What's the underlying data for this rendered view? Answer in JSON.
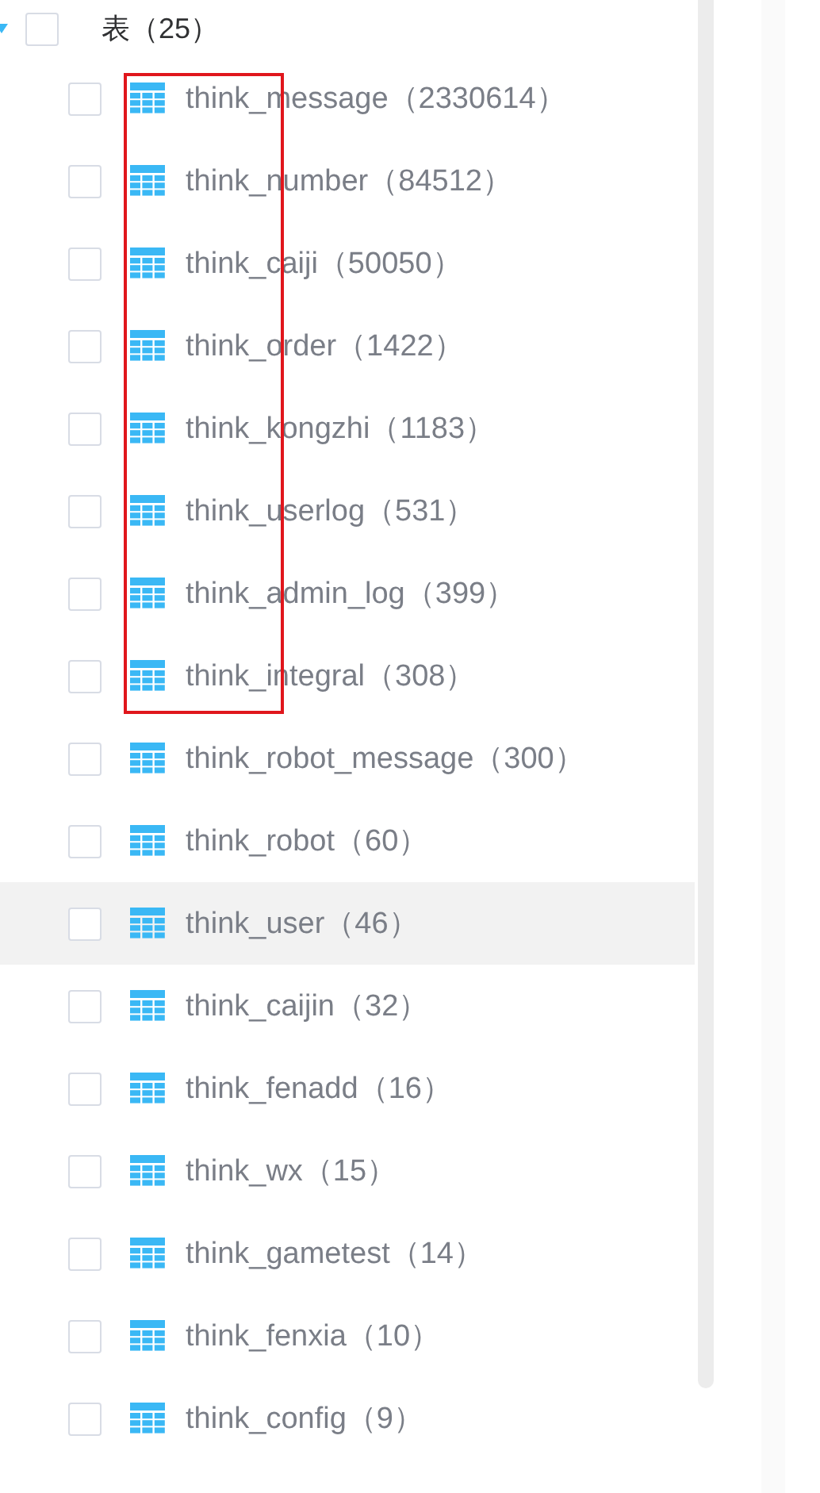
{
  "annotation": {
    "kind": "frame"
  },
  "tree": {
    "label": "表（25）",
    "expanded": true,
    "checked": false,
    "children": [
      {
        "label": "think_message（2330614）",
        "checked": false,
        "hovered": false
      },
      {
        "label": "think_number（84512）",
        "checked": false,
        "hovered": false
      },
      {
        "label": "think_caiji（50050）",
        "checked": false,
        "hovered": false
      },
      {
        "label": "think_order（1422）",
        "checked": false,
        "hovered": false
      },
      {
        "label": "think_kongzhi（1183）",
        "checked": false,
        "hovered": false
      },
      {
        "label": "think_userlog（531）",
        "checked": false,
        "hovered": false
      },
      {
        "label": "think_admin_log（399）",
        "checked": false,
        "hovered": false
      },
      {
        "label": "think_integral（308）",
        "checked": false,
        "hovered": false
      },
      {
        "label": "think_robot_message（300）",
        "checked": false,
        "hovered": false
      },
      {
        "label": "think_robot（60）",
        "checked": false,
        "hovered": false
      },
      {
        "label": "think_user（46）",
        "checked": false,
        "hovered": true
      },
      {
        "label": "think_caijin（32）",
        "checked": false,
        "hovered": false
      },
      {
        "label": "think_fenadd（16）",
        "checked": false,
        "hovered": false
      },
      {
        "label": "think_wx（15）",
        "checked": false,
        "hovered": false
      },
      {
        "label": "think_gametest（14）",
        "checked": false,
        "hovered": false
      },
      {
        "label": "think_fenxia（10）",
        "checked": false,
        "hovered": false
      },
      {
        "label": "think_config（9）",
        "checked": false,
        "hovered": false
      }
    ]
  }
}
